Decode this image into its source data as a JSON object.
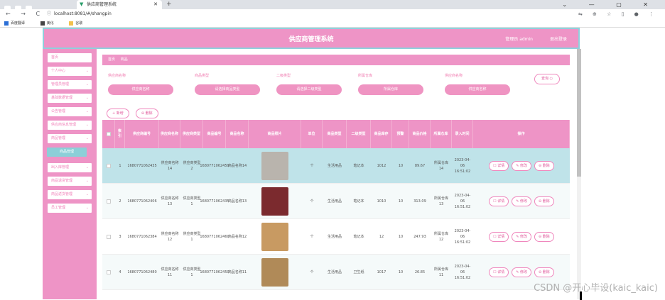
{
  "browser": {
    "tab_title": "供应商管理系统",
    "url": "localhost:8081/#/shangpin",
    "bookmarks": [
      "百度翻译",
      "美化",
      "谷歌"
    ]
  },
  "header": {
    "title": "供应商管理系统",
    "user": "管理员 admin",
    "logout": "退出登录"
  },
  "sidebar": {
    "items": [
      {
        "label": "首页",
        "chevron": false
      },
      {
        "label": "个人中心",
        "chevron": true
      },
      {
        "label": "管理员管理",
        "chevron": true
      },
      {
        "label": "基础数据管理",
        "chevron": true
      },
      {
        "label": "公告管理",
        "chevron": true
      },
      {
        "label": "供应商信息管理",
        "chevron": true
      },
      {
        "label": "商品管理",
        "chevron": true
      },
      {
        "label": "商品管理",
        "chevron": false,
        "active": true
      },
      {
        "label": "出入库管理",
        "chevron": true
      },
      {
        "label": "商品退货管理",
        "chevron": true
      },
      {
        "label": "商品返货管理",
        "chevron": true
      },
      {
        "label": "员工管理",
        "chevron": true
      }
    ]
  },
  "breadcrumb": [
    "首页",
    "商品"
  ],
  "filters": [
    {
      "label": "供应商名称",
      "placeholder": "供应商名称"
    },
    {
      "label": "商品类型",
      "placeholder": "请选择商品类型"
    },
    {
      "label": "二级类型",
      "placeholder": "请选择二级类型"
    },
    {
      "label": "所属仓库",
      "placeholder": "所属仓库"
    },
    {
      "label": "供应商名称",
      "placeholder": "供应商名称"
    }
  ],
  "search_label": "查询 ○",
  "add_label": "+ 新增",
  "delete_label": "⊖ 删除",
  "columns": [
    "索引",
    "供应商编号",
    "供应商名称",
    "供应商类型",
    "商品编号",
    "商品名称",
    "商品照片",
    "单位",
    "商品类型",
    "二级类型",
    "商品库存",
    "预警",
    "商品价格",
    "所属仓库",
    "录入时间",
    "操作"
  ],
  "op_labels": {
    "detail": "☐ 详情",
    "edit": "✎ 修改",
    "del": "⊖ 删除"
  },
  "rows": [
    {
      "idx": "1",
      "supplier_no": "1680771062435",
      "supplier_name": "供应商名称14",
      "supplier_type": "供应商类型2",
      "goods_no": "1680771062459",
      "goods_name": "商品名称14",
      "unit": "个",
      "goods_type": "生活用品",
      "sub_type": "笔记本",
      "stock": "1012",
      "warn": "10",
      "price": "89.67",
      "warehouse": "所属仓库14",
      "time": "2023-04-06 16:51:02",
      "thumb": "#b9b4ad"
    },
    {
      "idx": "2",
      "supplier_no": "1680771062406",
      "supplier_name": "供应商名称13",
      "supplier_type": "供应商类型1",
      "goods_no": "1680771062435",
      "goods_name": "商品名称13",
      "unit": "个",
      "goods_type": "生活用品",
      "sub_type": "笔记本",
      "stock": "1010",
      "warn": "10",
      "price": "313.09",
      "warehouse": "所属仓库13",
      "time": "2023-04-06 16:51:02",
      "thumb": "#7b2a2e"
    },
    {
      "idx": "3",
      "supplier_no": "1680771062384",
      "supplier_name": "供应商名称12",
      "supplier_type": "供应商类型1",
      "goods_no": "1680771062460",
      "goods_name": "商品名称12",
      "unit": "个",
      "goods_type": "生活用品",
      "sub_type": "笔记本",
      "stock": "12",
      "warn": "10",
      "price": "247.93",
      "warehouse": "所属仓库12",
      "time": "2023-04-06 16:51:02",
      "thumb": "#c89a62"
    },
    {
      "idx": "4",
      "supplier_no": "1680771062480",
      "supplier_name": "供应商名称11",
      "supplier_type": "供应商类型1",
      "goods_no": "1680771062450",
      "goods_name": "商品名称11",
      "unit": "个",
      "goods_type": "生活用品",
      "sub_type": "卫生纸",
      "stock": "1017",
      "warn": "10",
      "price": "26.85",
      "warehouse": "所属仓库11",
      "time": "2023-04-06 16:51:02",
      "thumb": "#b08a58"
    }
  ],
  "watermark": "CSDN @开心毕设(kaic_kaic)",
  "colors": {
    "pink": "#ee94c6",
    "teal": "#8fd0dc",
    "row_highlight": "#bfe3e9"
  }
}
